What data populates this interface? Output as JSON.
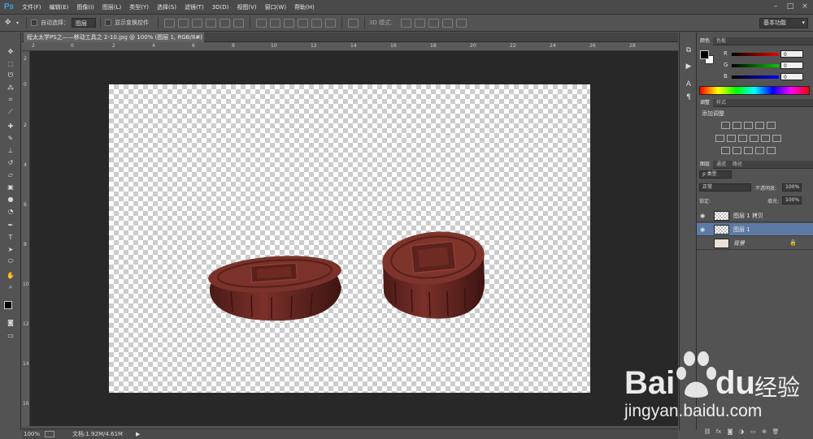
{
  "app": {
    "logo": "Ps"
  },
  "menu": [
    "文件(F)",
    "编辑(E)",
    "图像(I)",
    "图层(L)",
    "类型(Y)",
    "选择(S)",
    "滤镜(T)",
    "3D(D)",
    "视图(V)",
    "窗口(W)",
    "帮助(H)"
  ],
  "window_controls": {
    "minimize": "–",
    "maximize": "□",
    "close": "×"
  },
  "options": {
    "auto_select_label": "自动选择：",
    "auto_select_value": "图层",
    "show_transform_label": "显示变换控件",
    "mode_3d_label": "3D 模式：",
    "workspace": "基本功能"
  },
  "document": {
    "tab_title": "程太太学PS之——移动工具之 2-10.jpg @ 100% (图层 1, RGB/8#) *",
    "tab_close": "×"
  },
  "rulers": {
    "top": [
      "2",
      "0",
      "2",
      "4",
      "6",
      "8",
      "10",
      "12",
      "14",
      "16",
      "18",
      "20",
      "22",
      "24",
      "26",
      "28"
    ],
    "left": [
      "2",
      "0",
      "2",
      "4",
      "6",
      "8",
      "10",
      "12",
      "14",
      "16"
    ]
  },
  "status": {
    "zoom": "100%",
    "doc_label": "文档:1.92M/4.61M",
    "arrow": "▶"
  },
  "color_panel": {
    "tabs": [
      "颜色",
      "色板"
    ],
    "r_label": "R",
    "r_value": "0",
    "g_label": "G",
    "g_value": "0",
    "b_label": "B",
    "b_value": "0"
  },
  "adjust_panel": {
    "tabs": [
      "调整",
      "样式"
    ],
    "title": "添加调整"
  },
  "layers_panel": {
    "tabs": [
      "图层",
      "通道",
      "路径"
    ],
    "kind_label": "ρ 类型",
    "blend_mode": "正常",
    "opacity_label": "不透明度:",
    "opacity_value": "100%",
    "lock_label": "锁定:",
    "fill_label": "填充:",
    "fill_value": "100%",
    "layers": [
      {
        "name": "图层 1 拷贝",
        "visible": true,
        "selected": false
      },
      {
        "name": "图层 1",
        "visible": true,
        "selected": true
      },
      {
        "name": "背景",
        "visible": false,
        "selected": false,
        "locked": true
      }
    ]
  },
  "watermark": {
    "brand_bai": "Bai",
    "brand_du": "du",
    "brand_cn": "经验",
    "url": "jingyan.baidu.com"
  },
  "colors": {
    "accent_blue": "#3ca3e4",
    "mooncake": "#6e2a24",
    "selected_layer": "#5d7aa6"
  }
}
